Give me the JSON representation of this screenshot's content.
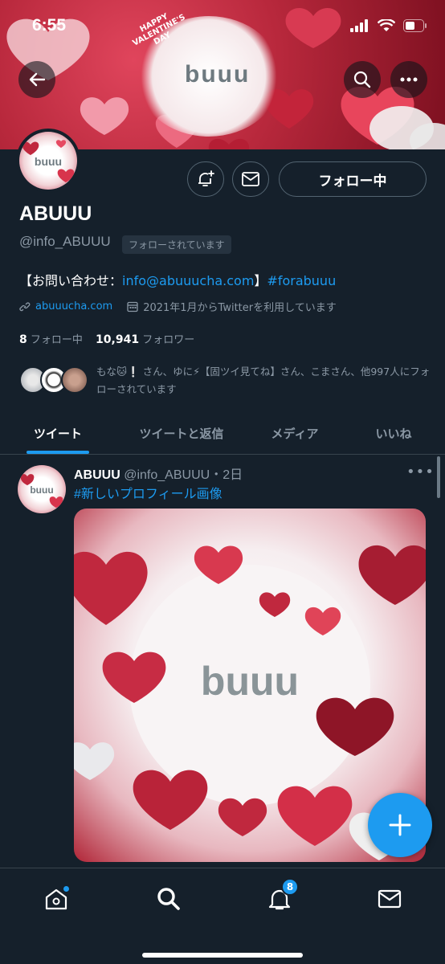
{
  "status_bar": {
    "time": "6:55"
  },
  "banner": {
    "logo_text": "buuu",
    "valentines_text": "HAPPY VALENTINE'S DAY"
  },
  "profile": {
    "display_name": "ABUUU",
    "handle": "@info_ABUUU",
    "follows_you": "フォローされています",
    "follow_button": "フォロー中",
    "bio_prefix": "【お問い合わせ：",
    "bio_email": "info@abuuucha.com",
    "bio_mid": "】",
    "bio_hashtag": "#forabuuu",
    "url": "abuuucha.com",
    "joined": "2021年1月からTwitterを利用しています",
    "following_count": "8",
    "following_label": "フォロー中",
    "followers_count": "10,941",
    "followers_label": "フォロワー",
    "followed_by_text": "もな🐱❕ さん、ゆに⚡【固ツイ見てね】さん、こまさん、他997人にフォローされています"
  },
  "tabs": [
    {
      "label": "ツイート",
      "active": true
    },
    {
      "label": "ツイートと返信",
      "active": false
    },
    {
      "label": "メディア",
      "active": false
    },
    {
      "label": "いいね",
      "active": false
    }
  ],
  "tweet": {
    "name": "ABUUU",
    "handle": "@info_ABUUU",
    "time": "・2日",
    "text": "#新しいプロフィール画像",
    "image_logo": "buuu"
  },
  "bottom_nav": {
    "notifications_badge": "8"
  },
  "colors": {
    "accent": "#1d9bf0",
    "background": "#15202b",
    "muted": "#8b98a5",
    "heart_red": "#c0283e"
  }
}
